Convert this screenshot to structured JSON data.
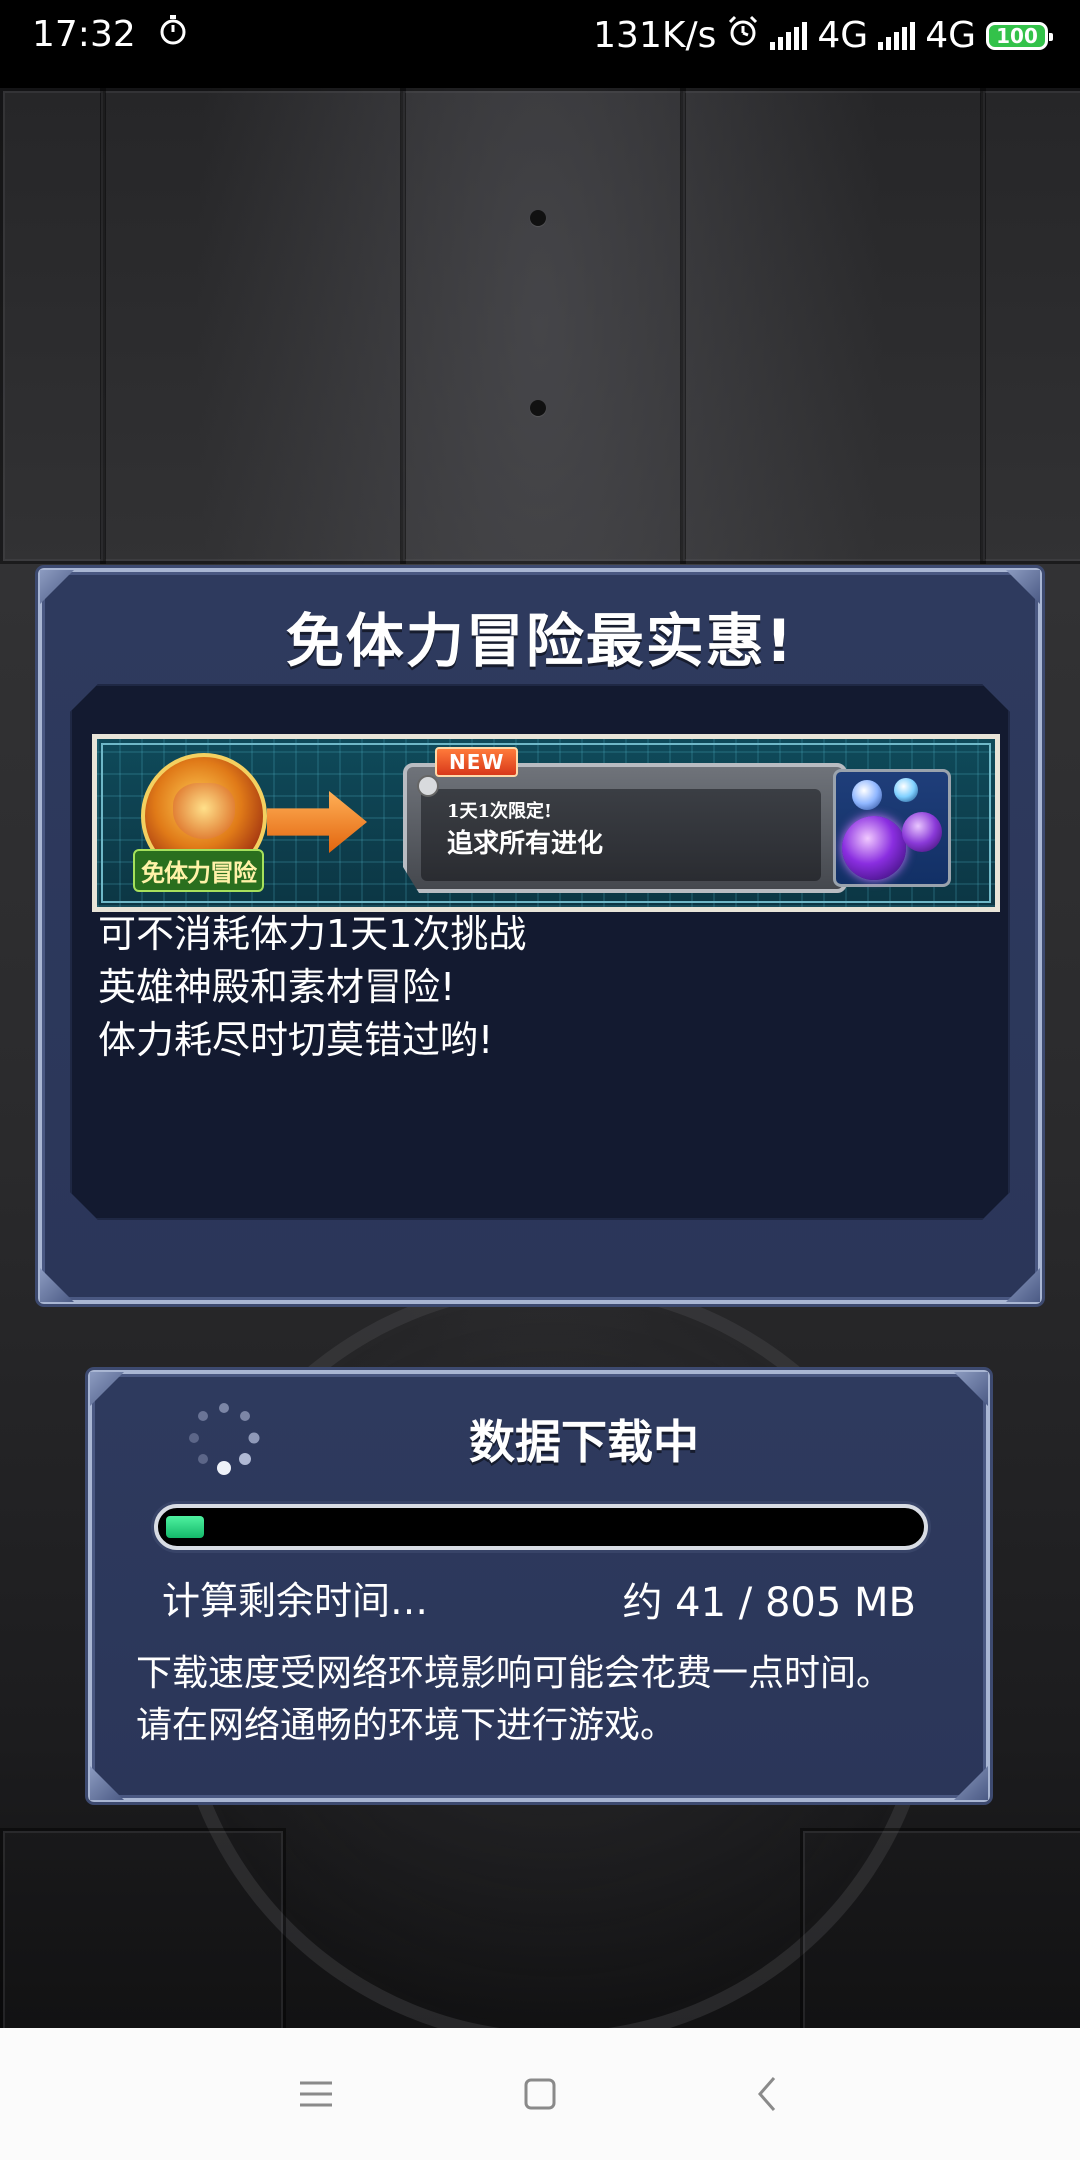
{
  "status_bar": {
    "time": "17:32",
    "net_speed": "131K/s",
    "sim1": "4G",
    "sim2": "4G",
    "battery": "100",
    "icons": [
      "stopwatch-icon",
      "alarm-icon",
      "signal-icon",
      "battery-icon"
    ]
  },
  "announcement": {
    "title": "免体力冒险最实惠!",
    "banner": {
      "medal_label": "免体力冒险",
      "new_badge": "NEW",
      "quest_subtitle": "1天1次限定!",
      "quest_title": "追求所有进化"
    },
    "lines": [
      "可不消耗体力1天1次挑战",
      "英雄神殿和素材冒险!",
      "体力耗尽时切莫错过哟!"
    ]
  },
  "download": {
    "title": "数据下载中",
    "remaining_label": "计算剩余时间…",
    "size_label": "约 41 / 805 MB",
    "progress_fraction": 0.051,
    "notice": [
      "下载速度受网络环境影响可能会花费一点时间。",
      "请在网络通畅的环境下进行游戏。"
    ]
  },
  "colors": {
    "panel_blue": "#2e3a5e",
    "panel_border": "#a9b6d3",
    "progress_green": "#1fd27c",
    "dark_inset": "#131a30"
  }
}
